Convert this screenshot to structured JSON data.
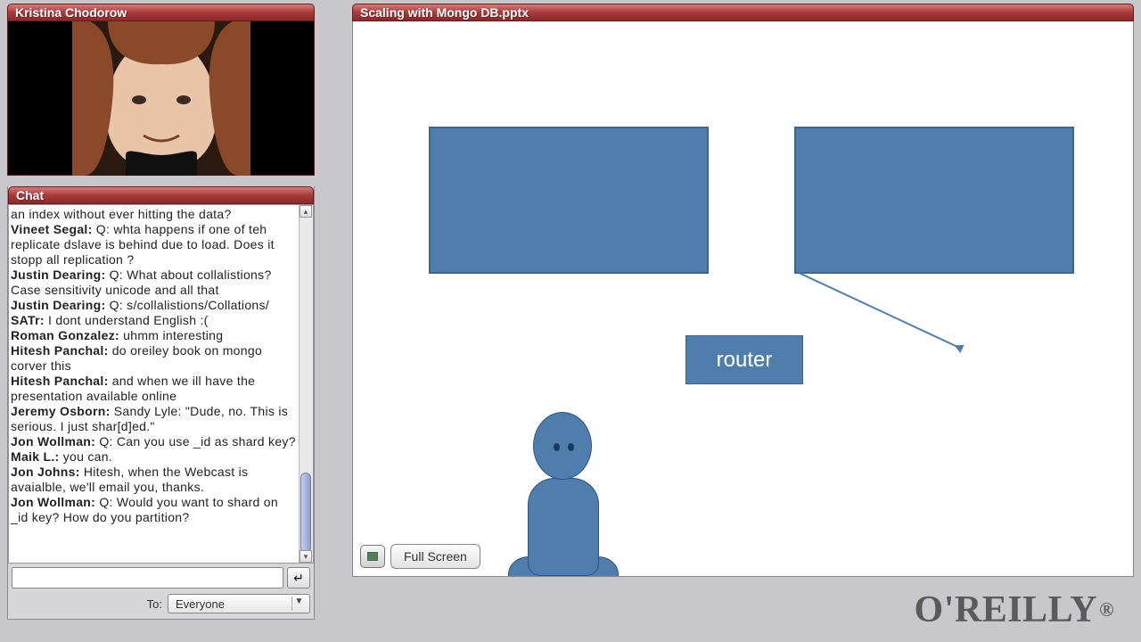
{
  "presenter": {
    "name": "Kristina Chodorow"
  },
  "chat": {
    "title": "Chat",
    "to_label": "To:",
    "to_value": "Everyone",
    "send_icon": "↵",
    "messages": [
      {
        "author": "",
        "text": "an index without ever hitting the data?"
      },
      {
        "author": "Vineet Segal:",
        "text": " Q: whta happens if one of teh replicate dslave is behind due to load. Does it stopp all replication ?"
      },
      {
        "author": "Justin Dearing:",
        "text": " Q: What about collalistions? Case sensitivity unicode and all that"
      },
      {
        "author": "Justin Dearing:",
        "text": " Q: s/collalistions/Collations/"
      },
      {
        "author": "SATr:",
        "text": " I dont understand English :("
      },
      {
        "author": "Roman Gonzalez:",
        "text": " uhmm interesting"
      },
      {
        "author": "Hitesh Panchal:",
        "text": " do oreiley book on mongo corver this"
      },
      {
        "author": "Hitesh Panchal:",
        "text": " and when we ill have the presentation available online"
      },
      {
        "author": "Jeremy Osborn:",
        "text": " Sandy Lyle: \"Dude, no. This is serious. I just shar[d]ed.\""
      },
      {
        "author": "Jon Wollman:",
        "text": " Q: Can you use _id as shard key?"
      },
      {
        "author": "Maik L.:",
        "text": " you can."
      },
      {
        "author": "Jon Johns:",
        "text": " Hitesh, when the Webcast is avaialble, we'll email you, thanks."
      },
      {
        "author": "Jon Wollman:",
        "text": " Q: Would you want to shard on _id key? How do you partition?"
      }
    ]
  },
  "presentation": {
    "title": "Scaling with Mongo DB.pptx",
    "router_label": "router",
    "fullscreen_label": "Full Screen"
  },
  "logo": {
    "text": "O'REILLY",
    "reg": "®"
  }
}
